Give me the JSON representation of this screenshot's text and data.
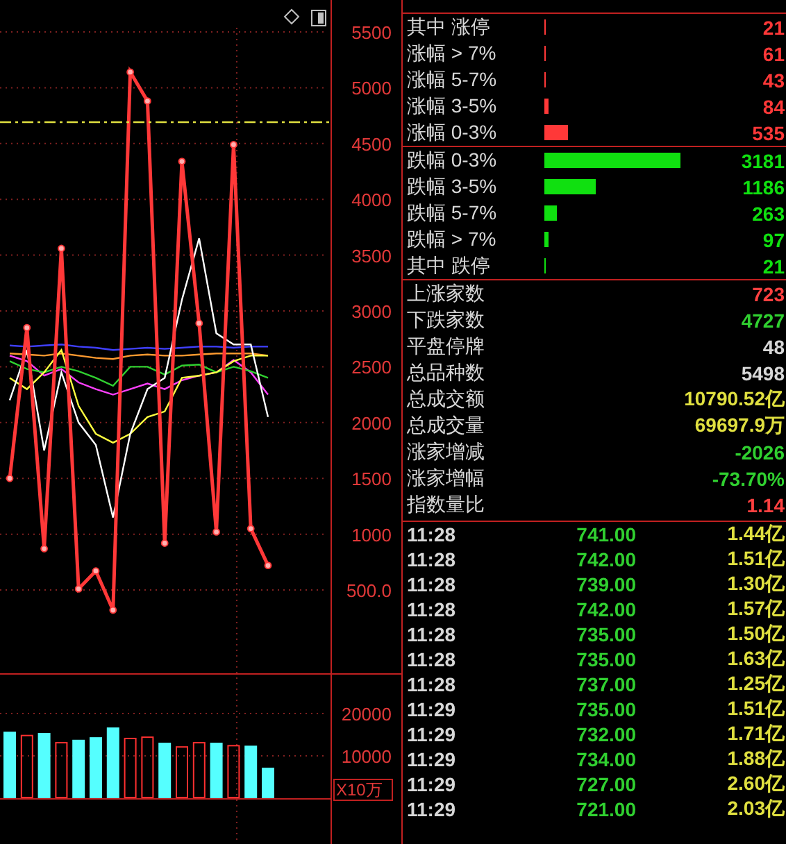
{
  "main_chart": {
    "chart_data": {
      "type": "line",
      "grid": true,
      "ylim": [
        -246,
        5786
      ],
      "yticks": [
        {
          "value": 500,
          "label": "500.0"
        },
        1000,
        1500,
        2000,
        2500,
        3000,
        3500,
        4000,
        4500,
        5000,
        5500
      ],
      "series": [
        {
          "color": "#ff3838",
          "marker": "o",
          "values": [
            1500,
            2850,
            870,
            3560,
            510,
            670,
            320,
            5140,
            4880,
            920,
            4340,
            2890,
            1020,
            4490,
            1050,
            720
          ]
        },
        {
          "color": "#ffffff",
          "values": [
            2200,
            2650,
            1750,
            2450,
            2000,
            1800,
            1150,
            1900,
            2300,
            2400,
            3100,
            3650,
            2800,
            2700,
            2700,
            2050
          ]
        },
        {
          "color": "#ffff40",
          "values": [
            2400,
            2300,
            2450,
            2650,
            2150,
            1900,
            1820,
            1900,
            2050,
            2100,
            2400,
            2420,
            2450,
            2550,
            2600,
            2600
          ]
        },
        {
          "color": "#30d030",
          "values": [
            2550,
            2480,
            2450,
            2500,
            2460,
            2400,
            2330,
            2500,
            2500,
            2430,
            2510,
            2520,
            2450,
            2500,
            2460,
            2400
          ]
        },
        {
          "color": "#ff40ff",
          "values": [
            2600,
            2550,
            2420,
            2480,
            2360,
            2300,
            2250,
            2300,
            2350,
            2300,
            2380,
            2420,
            2450,
            2560,
            2450,
            2250
          ]
        },
        {
          "color": "#ff9a30",
          "values": [
            2620,
            2610,
            2600,
            2620,
            2600,
            2580,
            2570,
            2600,
            2610,
            2600,
            2600,
            2610,
            2620,
            2620,
            2620,
            2600
          ]
        },
        {
          "color": "#4040ff",
          "values": [
            2690,
            2680,
            2690,
            2700,
            2680,
            2670,
            2650,
            2660,
            2670,
            2660,
            2670,
            2680,
            2680,
            2670,
            2680,
            2680
          ]
        }
      ]
    }
  },
  "volume_chart": {
    "chart_data": {
      "type": "bar",
      "grid": true,
      "ylabel": "X10万",
      "yticks": [
        10000,
        20000
      ],
      "ylim": [
        0,
        29500
      ],
      "series": [
        {
          "color": "#55ffff",
          "values": [
            15700,
            null,
            15400,
            null,
            13800,
            14400,
            16700,
            null,
            null,
            13100,
            null,
            null,
            13100,
            null,
            12400,
            7200
          ]
        },
        {
          "color": "#ff3030",
          "values": [
            null,
            14800,
            null,
            13100,
            null,
            null,
            null,
            14100,
            14400,
            null,
            12100,
            13100,
            null,
            12400,
            null,
            null
          ]
        }
      ]
    }
  },
  "advance_groups": [
    {
      "label": "其中 涨停",
      "value": "21",
      "level": 0.01
    },
    {
      "label": "涨幅 > 7%",
      "value": "61",
      "level": 0.01
    },
    {
      "label": "涨幅 5-7%",
      "value": "43",
      "level": 0.01
    },
    {
      "label": "涨幅 3-5%",
      "value": "84",
      "level": 0.03
    },
    {
      "label": "涨幅 0-3%",
      "value": "535",
      "level": 0.17
    }
  ],
  "decline_groups": [
    {
      "label": "跌幅 0-3%",
      "value": "3181",
      "level": 0.98
    },
    {
      "label": "跌幅 3-5%",
      "value": "1186",
      "level": 0.37
    },
    {
      "label": "跌幅 5-7%",
      "value": "263",
      "level": 0.09
    },
    {
      "label": "跌幅 > 7%",
      "value": "97",
      "level": 0.03
    },
    {
      "label": "其中 跌停",
      "value": "21",
      "level": 0.01
    }
  ],
  "stats": [
    {
      "label": "上涨家数",
      "value": "723",
      "color": "#ff4040"
    },
    {
      "label": "下跌家数",
      "value": "4727",
      "color": "#30d030"
    },
    {
      "label": "平盘停牌",
      "value": "48",
      "color": "#d8d8d8"
    },
    {
      "label": "总品种数",
      "value": "5498",
      "color": "#d8d8d8"
    },
    {
      "label": "总成交额",
      "value": "10790.52亿",
      "color": "#e0e040"
    },
    {
      "label": "总成交量",
      "value": "69697.9万",
      "color": "#e0e040"
    },
    {
      "label": "涨家增减",
      "value": "-2026",
      "color": "#30d030"
    },
    {
      "label": "涨家增幅",
      "value": "-73.70%",
      "color": "#30d030"
    },
    {
      "label": "指数量比",
      "value": "1.14",
      "color": "#ff4040"
    }
  ],
  "ticks": [
    {
      "time": "11:28",
      "price": "741.00",
      "amount": "1.44亿"
    },
    {
      "time": "11:28",
      "price": "742.00",
      "amount": "1.51亿"
    },
    {
      "time": "11:28",
      "price": "739.00",
      "amount": "1.30亿"
    },
    {
      "time": "11:28",
      "price": "742.00",
      "amount": "1.57亿"
    },
    {
      "time": "11:28",
      "price": "735.00",
      "amount": "1.50亿"
    },
    {
      "time": "11:28",
      "price": "735.00",
      "amount": "1.63亿"
    },
    {
      "time": "11:28",
      "price": "737.00",
      "amount": "1.25亿"
    },
    {
      "time": "11:29",
      "price": "735.00",
      "amount": "1.51亿"
    },
    {
      "time": "11:29",
      "price": "732.00",
      "amount": "1.71亿"
    },
    {
      "time": "11:29",
      "price": "734.00",
      "amount": "1.88亿"
    },
    {
      "time": "11:29",
      "price": "727.00",
      "amount": "2.60亿"
    },
    {
      "time": "11:29",
      "price": "721.00",
      "amount": "2.03亿"
    }
  ]
}
